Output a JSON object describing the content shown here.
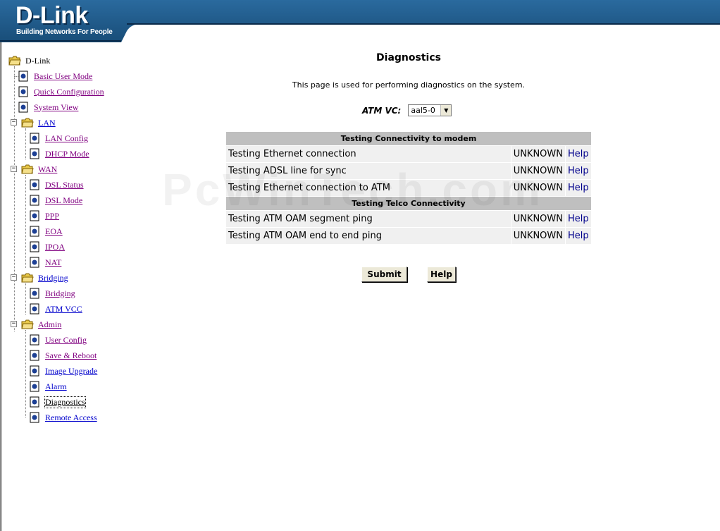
{
  "brand": {
    "logo": "D-Link",
    "tagline": "Building Networks For People",
    "colors": {
      "banner": "#1f5b8c",
      "banner_dark": "#0e3d63",
      "visited_link": "#800080",
      "link": "#0000cc"
    }
  },
  "tree": {
    "root": "D-Link",
    "items": [
      {
        "label": "Basic User Mode"
      },
      {
        "label": "Quick Configuration"
      },
      {
        "label": "System View"
      },
      {
        "label": "LAN"
      },
      {
        "label": "LAN Config"
      },
      {
        "label": "DHCP Mode"
      },
      {
        "label": "WAN"
      },
      {
        "label": "DSL Status"
      },
      {
        "label": "DSL Mode"
      },
      {
        "label": "PPP"
      },
      {
        "label": "EOA"
      },
      {
        "label": "IPOA"
      },
      {
        "label": "NAT"
      },
      {
        "label": "Bridging"
      },
      {
        "label": "Bridging"
      },
      {
        "label": "ATM VCC"
      },
      {
        "label": "Admin"
      },
      {
        "label": "User Config"
      },
      {
        "label": "Save & Reboot"
      },
      {
        "label": "Image Upgrade"
      },
      {
        "label": "Alarm"
      },
      {
        "label": "Diagnostics"
      },
      {
        "label": "Remote Access"
      }
    ]
  },
  "main": {
    "title": "Diagnostics",
    "description": "This page is used for performing diagnostics on the system.",
    "atm_vc": {
      "label": "ATM VC:",
      "selected": "aal5-0"
    },
    "sections": [
      {
        "header": "Testing Connectivity to modem",
        "rows": [
          {
            "test": "Testing Ethernet connection",
            "status": "UNKNOWN",
            "help": "Help"
          },
          {
            "test": "Testing ADSL line for sync",
            "status": "UNKNOWN",
            "help": "Help"
          },
          {
            "test": "Testing Ethernet connection to ATM",
            "status": "UNKNOWN",
            "help": "Help"
          }
        ]
      },
      {
        "header": "Testing Telco Connectivity",
        "rows": [
          {
            "test": "Testing ATM OAM segment ping",
            "status": "UNKNOWN",
            "help": "Help"
          },
          {
            "test": "Testing ATM OAM end to end ping",
            "status": "UNKNOWN",
            "help": "Help"
          }
        ]
      }
    ],
    "buttons": {
      "submit": "Submit",
      "help": "Help"
    },
    "watermark": "PcWinTech.com"
  }
}
